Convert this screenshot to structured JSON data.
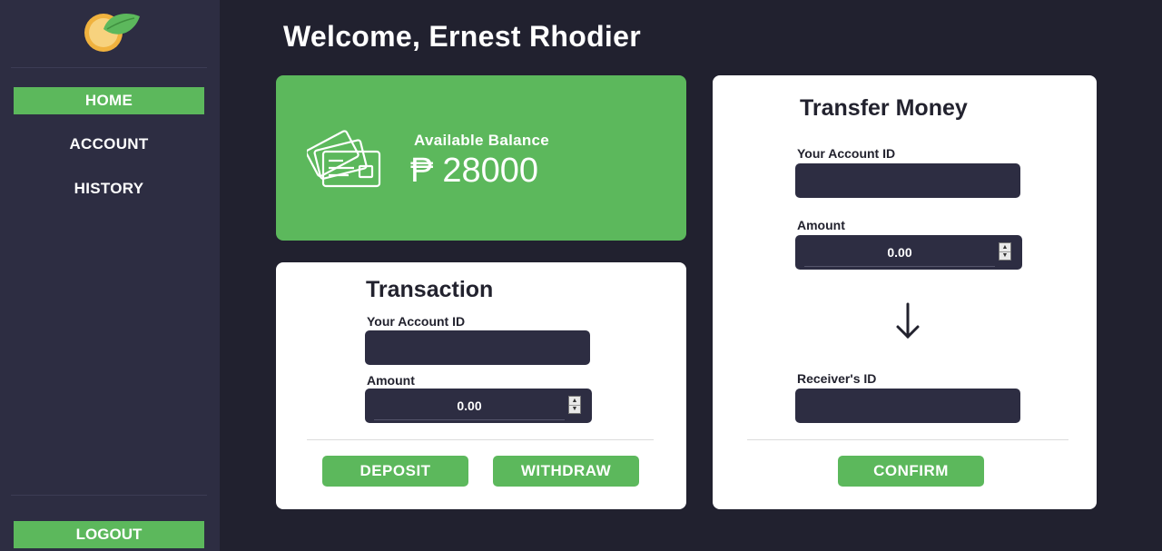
{
  "sidebar": {
    "nav": [
      {
        "label": "HOME",
        "active": true
      },
      {
        "label": "ACCOUNT",
        "active": false
      },
      {
        "label": "HISTORY",
        "active": false
      }
    ],
    "logout_label": "LOGOUT"
  },
  "header": {
    "welcome": "Welcome, Ernest Rhodier"
  },
  "balance": {
    "label": "Available Balance",
    "currency": "₱",
    "amount": "28000"
  },
  "transaction": {
    "title": "Transaction",
    "account_label": "Your Account ID",
    "account_value": "",
    "amount_label": "Amount",
    "amount_value": "0.00",
    "deposit_label": "DEPOSIT",
    "withdraw_label": "WITHDRAW"
  },
  "transfer": {
    "title": "Transfer Money",
    "account_label": "Your Account ID",
    "account_value": "",
    "amount_label": "Amount",
    "amount_value": "0.00",
    "receiver_label": "Receiver's ID",
    "receiver_value": "",
    "confirm_label": "CONFIRM"
  },
  "colors": {
    "accent": "#5cb85c",
    "background": "#21212f",
    "sidebar": "#2d2d42"
  }
}
